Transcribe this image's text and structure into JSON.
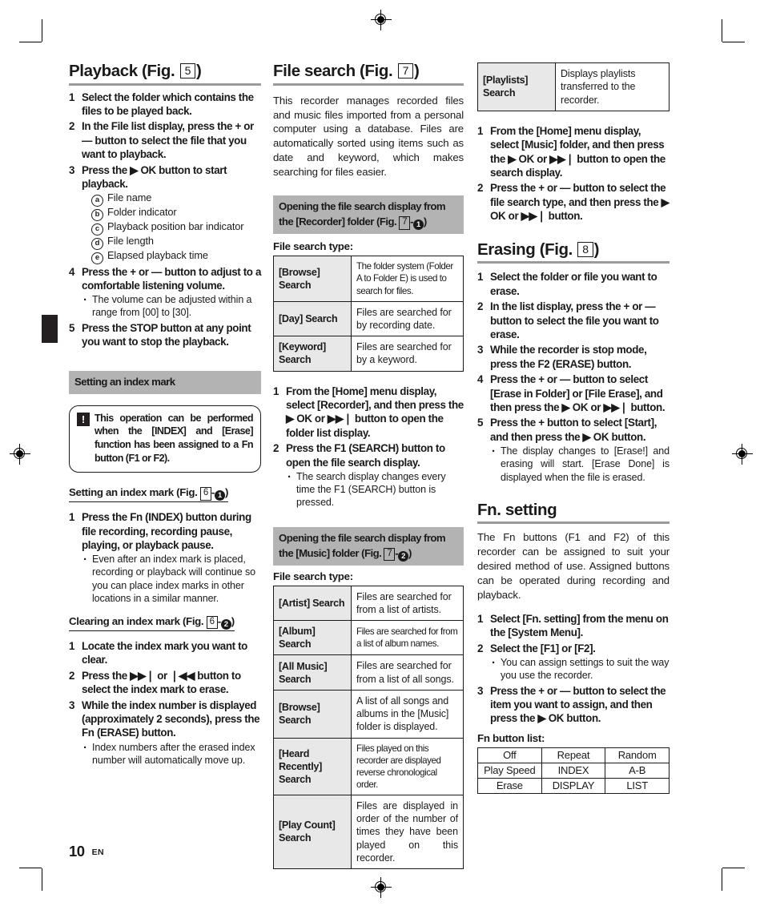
{
  "page": {
    "number": "10",
    "language": "EN"
  },
  "columns": {
    "left": {
      "playback": {
        "title_prefix": "Playback (Fig.",
        "title_fig": "5",
        "title_suffix": ")",
        "steps": [
          {
            "num": "1",
            "text": "Select the folder which contains the files to be played back."
          },
          {
            "num": "2",
            "text": "In the File list display, press the + or — button to select the file that you want to playback."
          },
          {
            "num": "3",
            "text": "Press the ▶ OK button to start playback."
          },
          {
            "num": "4",
            "text": "Press the + or — button to adjust to a comfortable listening volume."
          },
          {
            "num": "5",
            "text": "Press the STOP button at any point you want to stop the playback."
          }
        ],
        "callouts": [
          {
            "letter": "a",
            "text": "File name"
          },
          {
            "letter": "b",
            "text": "Folder indicator"
          },
          {
            "letter": "c",
            "text": "Playback position bar indicator"
          },
          {
            "letter": "d",
            "text": "File length"
          },
          {
            "letter": "e",
            "text": "Elapsed playback time"
          }
        ],
        "volume_note": "The volume can be adjusted within a range from [00] to [30]."
      },
      "index_mark": {
        "gray_heading": "Setting an index mark",
        "note": "This operation can be performed when the [INDEX] and [Erase] function has been assigned to a Fn button (F1 or F2).",
        "setting": {
          "heading_prefix": "Setting an index mark (Fig.",
          "heading_fig": "6",
          "heading_dash": "-",
          "heading_circle": "1",
          "heading_suffix": ")",
          "step_num": "1",
          "step_text": "Press the Fn (INDEX) button during file recording, recording pause, playing, or playback pause.",
          "bullet": "Even after an index mark is placed, recording or playback will continue so you can place index marks in other locations in a similar manner."
        },
        "clearing": {
          "heading_prefix": "Clearing an index mark (Fig.",
          "heading_fig": "6",
          "heading_dash": "-",
          "heading_circle": "2",
          "heading_suffix": ")",
          "steps": [
            {
              "num": "1",
              "text": "Locate the index mark you want to clear."
            },
            {
              "num": "2",
              "text": "Press the ▶▶❘ or ❘◀◀ button to select the index mark to erase."
            },
            {
              "num": "3",
              "text": "While the index number is displayed (approximately 2 seconds), press the Fn (ERASE) button."
            }
          ],
          "bullet": "Index numbers after the erased index number will automatically move up."
        }
      }
    },
    "middle": {
      "file_search": {
        "title_prefix": "File search (Fig.",
        "title_fig": "7",
        "title_suffix": ")",
        "intro": "This recorder manages recorded files and music files imported from a personal computer using a database. Files are automatically sorted using items such as date and keyword, which makes searching for files easier."
      },
      "recorder_section": {
        "gray_heading_line1": "Opening the file search display from",
        "gray_heading_line2_a": "the [Recorder] folder (Fig.",
        "gray_heading_fig": "7",
        "gray_heading_dash": "-",
        "gray_heading_circle": "1",
        "gray_heading_line2_b": ")",
        "table_label": "File search type:",
        "table_rows": [
          {
            "key": "[Browse] Search",
            "value": "The folder system (Folder A to Folder E) is used to search for files.",
            "tight": true
          },
          {
            "key": "[Day] Search",
            "value": "Files are searched for by recording date.",
            "tight": false
          },
          {
            "key": "[Keyword] Search",
            "value": "Files are searched for by a keyword.",
            "tight": false
          }
        ],
        "steps": [
          {
            "num": "1",
            "text": "From the [Home] menu display, select [Recorder], and then press the ▶ OK or ▶▶❘ button to open the folder list display."
          },
          {
            "num": "2",
            "text": "Press the F1 (SEARCH) button to open the file search display."
          }
        ],
        "bullet": "The search display changes every time the F1 (SEARCH) button is pressed."
      },
      "music_section": {
        "gray_heading_line1": "Opening the file search display from",
        "gray_heading_line2_a": "the [Music] folder (Fig.",
        "gray_heading_fig": "7",
        "gray_heading_dash": "-",
        "gray_heading_circle": "2",
        "gray_heading_line2_b": ")",
        "table_label": "File search type:",
        "table_rows": [
          {
            "key": "[Artist] Search",
            "value": "Files are searched for from a list of artists.",
            "tight": false
          },
          {
            "key": "[Album] Search",
            "value": "Files are searched for from a list of album names.",
            "tight": true
          },
          {
            "key": "[All Music] Search",
            "value": "Files are searched for from a list of all songs.",
            "tight": false
          },
          {
            "key": "[Browse] Search",
            "value": "A list of all songs and albums in the [Music] folder is displayed.",
            "tight": false
          },
          {
            "key": "[Heard Recently] Search",
            "value": "Files played on this recorder are displayed reverse chronological order.",
            "tight": true
          },
          {
            "key": "[Play Count] Search",
            "value": "Files are displayed in order of the number of times they have been played on this recorder.",
            "tight": false
          }
        ]
      }
    },
    "right": {
      "playlists_row": {
        "key": "[Playlists] Search",
        "value": "Displays playlists transferred to the recorder."
      },
      "music_steps": [
        {
          "num": "1",
          "text": "From the [Home] menu display, select [Music] folder, and then press the ▶ OK or ▶▶❘ button to open the search display."
        },
        {
          "num": "2",
          "text": "Press the + or — button to select the file search type, and then press the ▶ OK or ▶▶❘ button."
        }
      ],
      "erasing": {
        "title_prefix": "Erasing (Fig.",
        "title_fig": "8",
        "title_suffix": ")",
        "steps": [
          {
            "num": "1",
            "text": "Select the folder or file you want to erase."
          },
          {
            "num": "2",
            "text": "In the list display, press the + or — button to select the file you want to erase."
          },
          {
            "num": "3",
            "text": "While the recorder is stop mode, press the F2 (ERASE) button."
          },
          {
            "num": "4",
            "text": "Press the + or — button to select [Erase in Folder] or [File Erase], and then press the ▶ OK or ▶▶❘ button."
          },
          {
            "num": "5",
            "text": "Press the + button to select [Start], and then press the ▶ OK button."
          }
        ],
        "bullet": "The display changes to [Erase!] and erasing will start. [Erase Done] is displayed when the file is erased."
      },
      "fn_setting": {
        "title": "Fn. setting",
        "intro": "The Fn buttons (F1 and F2) of this recorder can be assigned to suit your desired method of use. Assigned buttons can be operated during recording and playback.",
        "steps": [
          {
            "num": "1",
            "text": "Select [Fn. setting] from the menu on the [System Menu]."
          },
          {
            "num": "2",
            "text": "Select the [F1] or [F2]."
          },
          {
            "num": "3",
            "text": "Press the + or — button to select the item you want to assign, and then press the ▶ OK button."
          }
        ],
        "bullet": "You can assign settings to suit the way you use the recorder.",
        "list_label": "Fn button list:",
        "list_rows": [
          [
            "Off",
            "Repeat",
            "Random"
          ],
          [
            "Play Speed",
            "INDEX",
            "A-B"
          ],
          [
            "Erase",
            "DISPLAY",
            "LIST"
          ]
        ]
      }
    }
  },
  "colors": {
    "gray_heading_bg": "#b3b3b3",
    "table_key_bg": "#e8e8e8",
    "rule": "#9a9a9a",
    "ink": "#1a1a1a",
    "tab": "#231f20"
  }
}
